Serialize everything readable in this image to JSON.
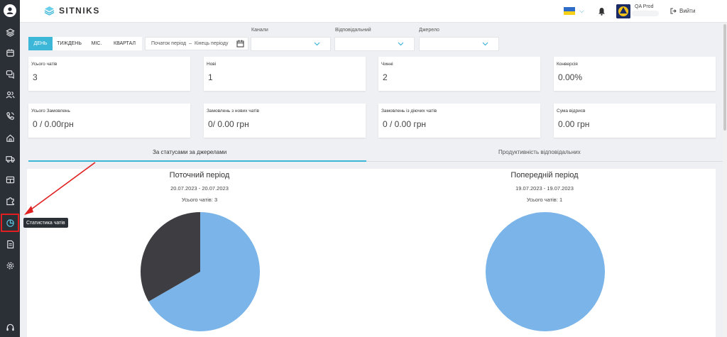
{
  "app": {
    "logo_text": "SITNIKS"
  },
  "sidebar": {
    "items": [
      {
        "name": "layers-icon"
      },
      {
        "name": "calendar-icon"
      },
      {
        "name": "chat-icon"
      },
      {
        "name": "users-icon"
      },
      {
        "name": "phone-icon"
      },
      {
        "name": "home-icon"
      },
      {
        "name": "truck-icon"
      },
      {
        "name": "table-icon"
      },
      {
        "name": "puzzle-icon"
      },
      {
        "name": "pie-chart-icon",
        "active": true
      },
      {
        "name": "document-icon"
      },
      {
        "name": "settings-icon"
      },
      {
        "name": "headset-icon"
      }
    ],
    "tooltip": "Статистика чатів"
  },
  "topbar": {
    "account_name": "QA Prod",
    "logout_label": "Вийти"
  },
  "filters": {
    "period_buttons": [
      "ДЕНЬ",
      "ТИЖДЕНЬ",
      "МІС.",
      "КВАРТАЛ"
    ],
    "active_period": "ДЕНЬ",
    "date_start_placeholder": "Початок період",
    "date_separator": "–",
    "date_end_placeholder": "Кінець періоду",
    "channels_label": "Канали",
    "responsible_label": "Відповідальний",
    "source_label": "Джерело"
  },
  "stats": [
    {
      "label": "Усього чатів",
      "value": "3"
    },
    {
      "label": "Нові",
      "value": "1"
    },
    {
      "label": "Чинні",
      "value": "2"
    },
    {
      "label": "Конверсія",
      "value": "0.00%"
    },
    {
      "label": "Усього Замовлень",
      "value": "0 / 0.00грн"
    },
    {
      "label": "Замовлень з нових чатів",
      "value": "0/ 0.00 грн"
    },
    {
      "label": "Замовлень із діючих чатів",
      "value": "0 / 0.00 грн"
    },
    {
      "label": "Сума відрисв",
      "value": "0.00 грн"
    }
  ],
  "tabs": [
    {
      "label": "За статусами за джерелами",
      "active": true
    },
    {
      "label": "Продуктивність відповідальних",
      "active": false
    }
  ],
  "current_period": {
    "title": "Поточний період",
    "dates": "20.07.2023 - 20.07.2023",
    "total": "Усього чатів: 3"
  },
  "previous_period": {
    "title": "Попередній період",
    "dates": "19.07.2023 - 19.07.2023",
    "total": "Усього чатів: 1"
  },
  "chart_data": [
    {
      "type": "pie",
      "title": "Поточний період",
      "values": [
        2,
        1
      ],
      "colors": [
        "#7ab4e9",
        "#3d3d42"
      ]
    },
    {
      "type": "pie",
      "title": "Попередній період",
      "values": [
        1
      ],
      "colors": [
        "#7ab4e9"
      ]
    }
  ],
  "colors": {
    "accent": "#3cb7d8",
    "sidebar": "#2b2f36",
    "highlight": "#e02020"
  }
}
